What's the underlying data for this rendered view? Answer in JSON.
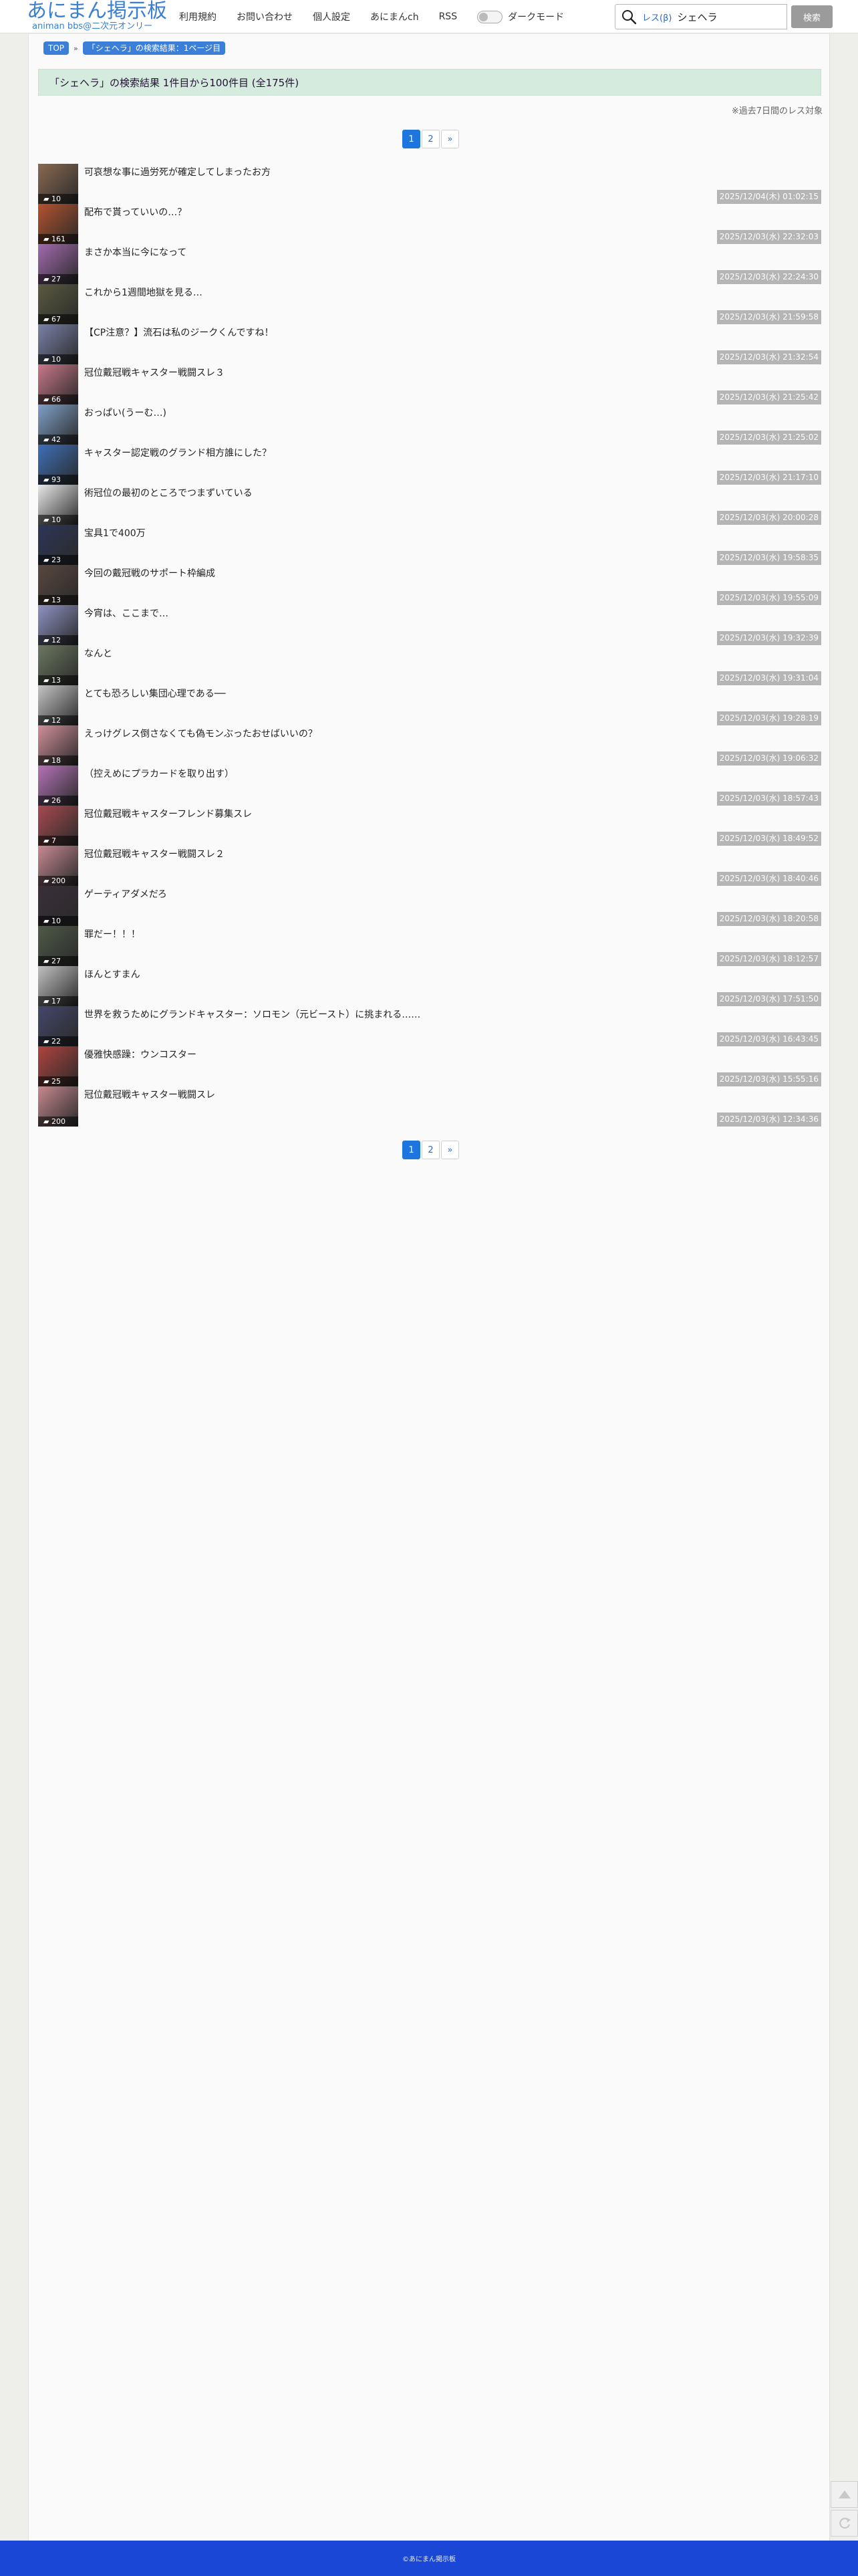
{
  "header": {
    "logo_title": "あにまん掲示板",
    "logo_sub": "animan bbs@二次元オンリー",
    "nav": [
      "利用規約",
      "お問い合わせ",
      "個人設定",
      "あにまんch",
      "RSS"
    ],
    "darkmode_label": "ダークモード",
    "darkmode_on": false,
    "search_mode": "レス(β)",
    "search_value": "シェヘラ",
    "search_button": "検索"
  },
  "breadcrumb": {
    "top": "TOP",
    "separator": "»",
    "current": "「シェヘラ」の検索結果：1ページ目"
  },
  "result_header": "「シェヘラ」の検索結果 1件目から100件目 (全175件)",
  "past_note": "※過去7日間のレス対象",
  "pagination": {
    "pages": [
      "1",
      "2"
    ],
    "current": "1",
    "next": "»"
  },
  "threads": [
    {
      "title": "可哀想な事に過労死が確定してしまったお方",
      "count": "10",
      "date": "2025/12/04(木) 01:02:15",
      "thumb": "#8a6a52"
    },
    {
      "title": "配布で貰っていいの…？",
      "count": "161",
      "date": "2025/12/03(水) 22:32:03",
      "thumb": "#b5532e"
    },
    {
      "title": "まさか本当に今になって",
      "count": "27",
      "date": "2025/12/03(水) 22:24:30",
      "thumb": "#a36bb0"
    },
    {
      "title": "これから1週間地獄を見る…",
      "count": "67",
      "date": "2025/12/03(水) 21:59:58",
      "thumb": "#5a5a40"
    },
    {
      "title": "【CP注意？】流石は私のジークくんですね！",
      "count": "10",
      "date": "2025/12/03(水) 21:32:54",
      "thumb": "#7a82a8"
    },
    {
      "title": "冠位戴冠戦キャスター戦闘スレ３",
      "count": "66",
      "date": "2025/12/03(水) 21:25:42",
      "thumb": "#c9788a"
    },
    {
      "title": "おっぱい(うーむ…)",
      "count": "42",
      "date": "2025/12/03(水) 21:25:02",
      "thumb": "#7fa0c8"
    },
    {
      "title": "キャスター認定戦のグランド相方誰にした？",
      "count": "93",
      "date": "2025/12/03(水) 21:17:10",
      "thumb": "#3f6fb8"
    },
    {
      "title": "術冠位の最初のところでつまずいている",
      "count": "10",
      "date": "2025/12/03(水) 20:00:28",
      "thumb": "#e8e8e8"
    },
    {
      "title": "宝具1で400万",
      "count": "23",
      "date": "2025/12/03(水) 19:58:35",
      "thumb": "#2e3658"
    },
    {
      "title": "今回の戴冠戦のサポート枠編成",
      "count": "13",
      "date": "2025/12/03(水) 19:55:09",
      "thumb": "#59483f"
    },
    {
      "title": "今宵は、ここまで…",
      "count": "12",
      "date": "2025/12/03(水) 19:32:39",
      "thumb": "#8f94c4"
    },
    {
      "title": "なんと",
      "count": "13",
      "date": "2025/12/03(水) 19:31:04",
      "thumb": "#6b7860"
    },
    {
      "title": "とても恐ろしい集団心理である──",
      "count": "12",
      "date": "2025/12/03(水) 19:28:19",
      "thumb": "#c4c4c4"
    },
    {
      "title": "えっけグレス倒さなくても偽モンぶったおせばいいの？",
      "count": "18",
      "date": "2025/12/03(水) 19:06:32",
      "thumb": "#d1909a"
    },
    {
      "title": "（控えめにプラカードを取り出す）",
      "count": "26",
      "date": "2025/12/03(水) 18:57:43",
      "thumb": "#b574b8"
    },
    {
      "title": "冠位戴冠戦キャスターフレンド募集スレ",
      "count": "7",
      "date": "2025/12/03(水) 18:49:52",
      "thumb": "#a84a50"
    },
    {
      "title": "冠位戴冠戦キャスター戦闘スレ２",
      "count": "200",
      "date": "2025/12/03(水) 18:40:46",
      "thumb": "#c98a94"
    },
    {
      "title": "ゲーティアダメだろ",
      "count": "10",
      "date": "2025/12/03(水) 18:20:58",
      "thumb": "#3a2f3a"
    },
    {
      "title": "罪だー！！！",
      "count": "27",
      "date": "2025/12/03(水) 18:12:57",
      "thumb": "#4f5a48"
    },
    {
      "title": "ほんとすまん",
      "count": "17",
      "date": "2025/12/03(水) 17:51:50",
      "thumb": "#c0c0c0"
    },
    {
      "title": "世界を救うためにグランドキャスター：ソロモン（元ビースト）に挑まれる……",
      "count": "22",
      "date": "2025/12/03(水) 16:43:45",
      "thumb": "#44486a"
    },
    {
      "title": "優雅快感躁：ウンコスター",
      "count": "25",
      "date": "2025/12/03(水) 15:55:16",
      "thumb": "#b04440"
    },
    {
      "title": "冠位戴冠戦キャスター戦闘スレ",
      "count": "200",
      "date": "2025/12/03(水) 12:34:36",
      "thumb": "#c68a8e"
    }
  ],
  "footer": "©あにまん掲示板"
}
